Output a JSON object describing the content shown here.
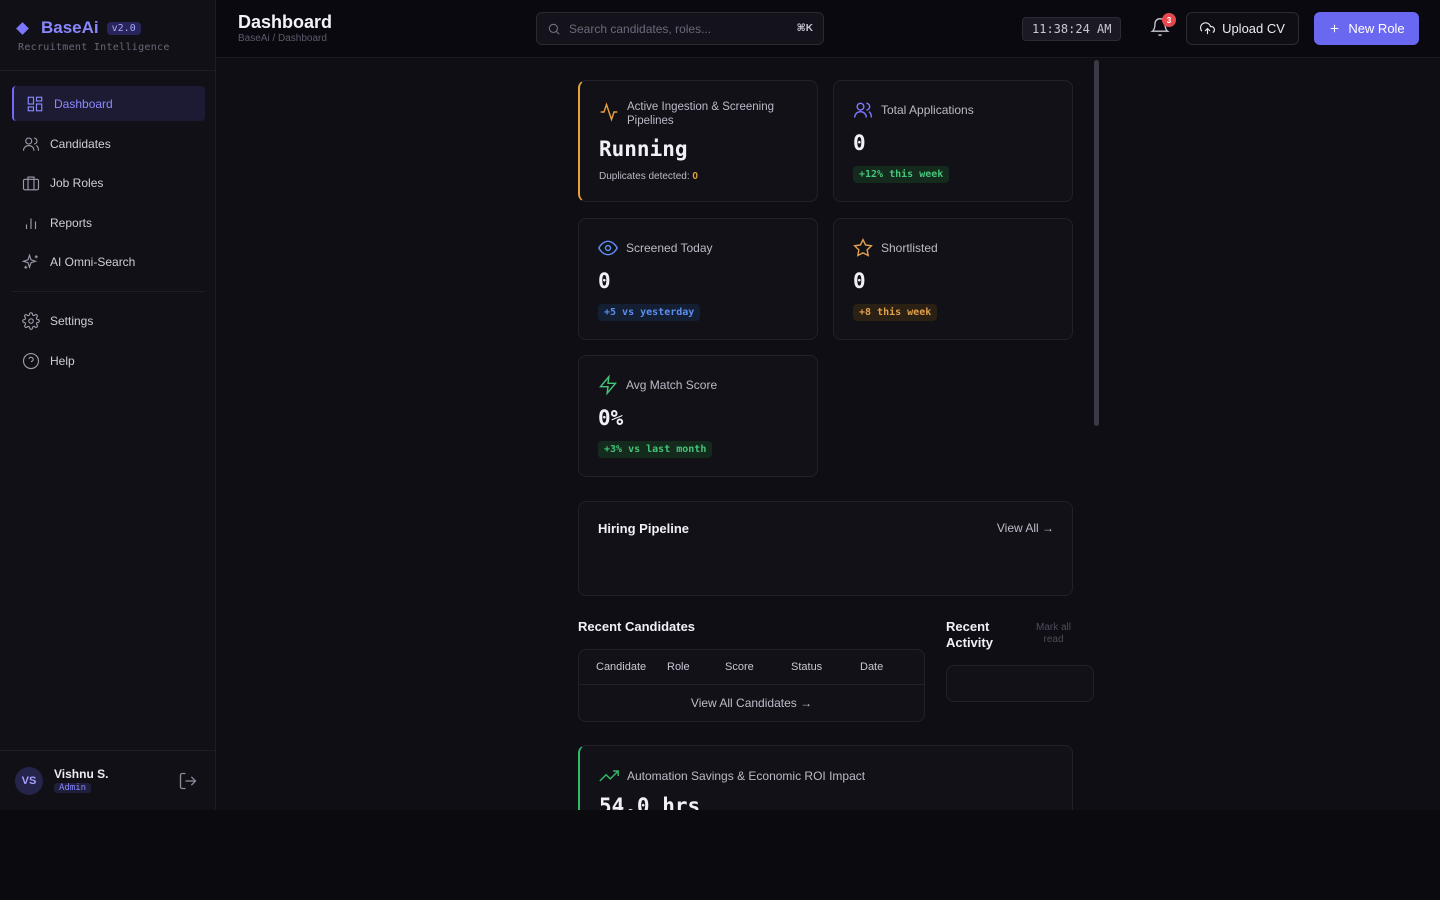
{
  "brand": {
    "name": "BaseAi",
    "version": "v2.0",
    "subtitle": "Recruitment Intelligence"
  },
  "sidebar": {
    "items": [
      {
        "label": "Dashboard",
        "icon": "grid-icon",
        "active": true
      },
      {
        "label": "Candidates",
        "icon": "users-icon"
      },
      {
        "label": "Job Roles",
        "icon": "briefcase-icon"
      },
      {
        "label": "Reports",
        "icon": "bar-chart-icon"
      },
      {
        "label": "AI Omni-Search",
        "icon": "sparkles-icon"
      }
    ],
    "secondary": [
      {
        "label": "Settings",
        "icon": "gear-icon"
      },
      {
        "label": "Help",
        "icon": "help-circle-icon"
      }
    ],
    "user": {
      "initials": "VS",
      "name": "Vishnu S.",
      "role": "Admin"
    }
  },
  "header": {
    "title": "Dashboard",
    "breadcrumb": "BaseAi / Dashboard",
    "search_placeholder": "Search candidates, roles...",
    "search_shortcut": "⌘K",
    "clock": "11:38:24 AM",
    "notification_count": "3",
    "upload_label": "Upload CV",
    "new_role_label": "New Role"
  },
  "stats": {
    "pipeline": {
      "label": "Active Ingestion & Screening Pipelines",
      "value": "Running",
      "duplicates_label": "Duplicates detected:",
      "duplicates_value": "0"
    },
    "applications": {
      "label": "Total Applications",
      "value": "0",
      "delta": "+12% this week"
    },
    "screened": {
      "label": "Screened Today",
      "value": "0",
      "delta": "+5 vs yesterday"
    },
    "shortlisted": {
      "label": "Shortlisted",
      "value": "0",
      "delta": "+8 this week"
    },
    "match": {
      "label": "Avg Match Score",
      "value": "0%",
      "delta": "+3% vs last month"
    }
  },
  "hiring_pipeline": {
    "title": "Hiring Pipeline",
    "link": "View All →"
  },
  "recent_candidates": {
    "title": "Recent Candidates",
    "columns": [
      "Candidate",
      "Role",
      "Score",
      "Status",
      "Date"
    ],
    "footer_link": "View All Candidates →"
  },
  "recent_activity": {
    "title_line1": "Recent",
    "title_line2": "Activity",
    "mark_line1": "Mark all",
    "mark_line2": "read"
  },
  "roi": {
    "label": "Automation Savings & Economic ROI Impact",
    "value": "54.0 hrs"
  },
  "colors": {
    "accent": "#6a67f0",
    "pipeline_border": "#e5a23a",
    "roi_border": "#35b86a"
  }
}
